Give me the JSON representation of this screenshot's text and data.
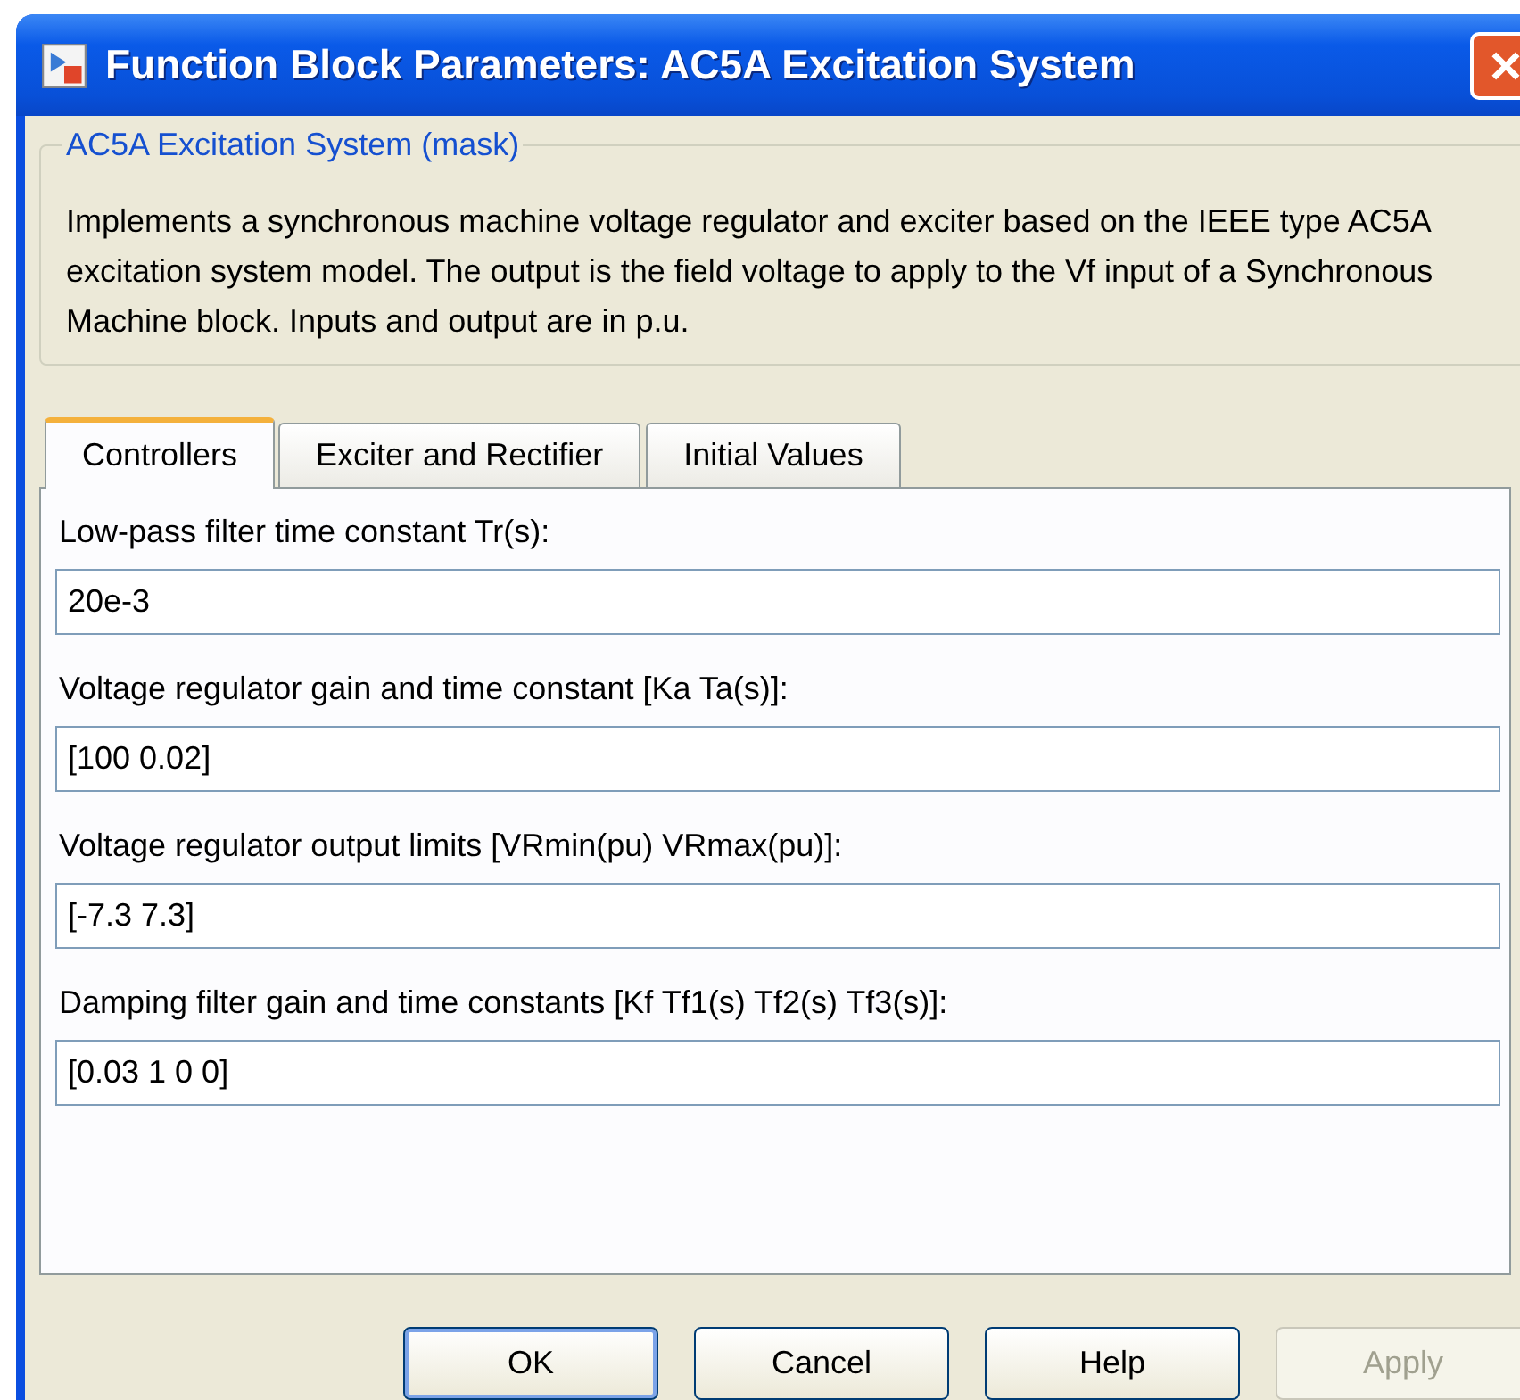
{
  "window": {
    "title": "Function Block Parameters: AC5A Excitation System"
  },
  "mask": {
    "legend": "AC5A Excitation System (mask)",
    "description": "Implements a synchronous machine voltage regulator and exciter based on the IEEE type AC5A excitation system model. The output is the field voltage to apply to the Vf input of a Synchronous Machine block. Inputs and output are in p.u."
  },
  "tabs": [
    {
      "label": "Controllers",
      "selected": true
    },
    {
      "label": "Exciter and Rectifier",
      "selected": false
    },
    {
      "label": "Initial Values",
      "selected": false
    }
  ],
  "parameters": [
    {
      "label": "Low-pass filter time constant Tr(s):",
      "value": "20e-3"
    },
    {
      "label": "Voltage regulator gain and time constant [Ka Ta(s)]:",
      "value": "[100 0.02]"
    },
    {
      "label": "Voltage regulator output limits [VRmin(pu) VRmax(pu)]:",
      "value": "[-7.3 7.3]"
    },
    {
      "label": "Damping filter gain and time constants [Kf Tf1(s) Tf2(s) Tf3(s)]:",
      "value": "[0.03 1 0 0]"
    }
  ],
  "buttons": [
    {
      "label": "OK",
      "disabled": false,
      "default": true
    },
    {
      "label": "Cancel",
      "disabled": false,
      "default": false
    },
    {
      "label": "Help",
      "disabled": false,
      "default": false
    },
    {
      "label": "Apply",
      "disabled": true,
      "default": false
    }
  ]
}
